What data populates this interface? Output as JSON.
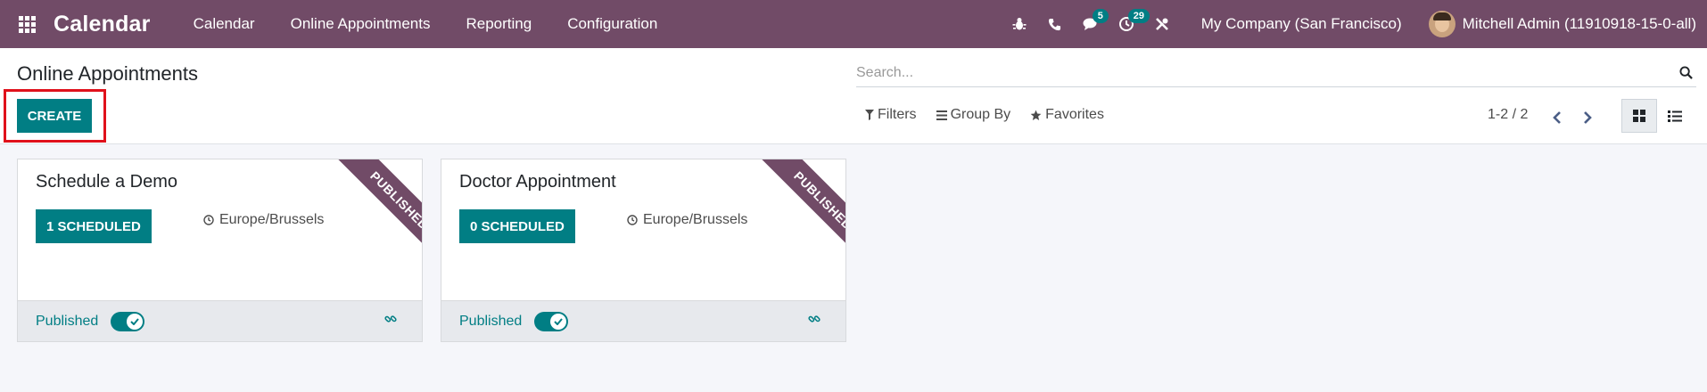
{
  "navbar": {
    "brand": "Calendar",
    "menu": [
      "Calendar",
      "Online Appointments",
      "Reporting",
      "Configuration"
    ],
    "messages_count": "5",
    "activities_count": "29",
    "company": "My Company (San Francisco)",
    "user": "Mitchell Admin (11910918-15-0-all)"
  },
  "control_panel": {
    "title": "Online Appointments",
    "create_label": "CREATE",
    "search_placeholder": "Search...",
    "filters_label": "Filters",
    "group_by_label": "Group By",
    "favorites_label": "Favorites",
    "pager": "1-2 / 2"
  },
  "cards": [
    {
      "title": "Schedule a Demo",
      "scheduled": "1 SCHEDULED",
      "timezone": "Europe/Brussels",
      "ribbon": "PUBLISHED",
      "published_label": "Published",
      "published": true
    },
    {
      "title": "Doctor Appointment",
      "scheduled": "0 SCHEDULED",
      "timezone": "Europe/Brussels",
      "ribbon": "PUBLISHED",
      "published_label": "Published",
      "published": true
    }
  ],
  "colors": {
    "brand": "#714b67",
    "primary": "#017e84",
    "highlight": "#e0111b"
  },
  "icons": {
    "apps": "apps-grid-icon",
    "bug": "bug-icon",
    "phone": "phone-icon",
    "chat": "chat-icon",
    "activity": "clock-icon",
    "tools": "tools-icon",
    "search": "search-icon",
    "filter": "filter-icon",
    "group_by": "list-icon",
    "favorites": "star-icon",
    "prev": "chevron-left-icon",
    "next": "chevron-right-icon",
    "kanban_view": "kanban-view-icon",
    "list_view": "list-view-icon",
    "timezone": "clock-icon",
    "link": "link-icon"
  }
}
